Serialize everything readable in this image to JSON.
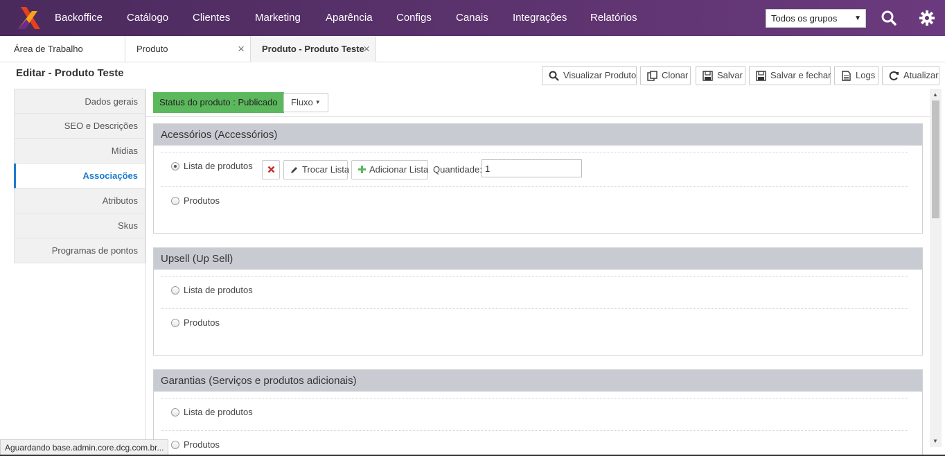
{
  "brand": {
    "logo_icon": "logo-x-icon",
    "accent": "#5e3470",
    "logo_colors": [
      "#e8401c",
      "#f7a21b",
      "#6a2c8a"
    ]
  },
  "nav": {
    "items": [
      "Backoffice",
      "Catálogo",
      "Clientes",
      "Marketing",
      "Aparência",
      "Configs",
      "Canais",
      "Integrações",
      "Relatórios"
    ],
    "group_select": "Todos os grupos",
    "search_icon": "search-icon",
    "settings_icon": "gear-icon"
  },
  "tabs": [
    {
      "label": "Área de Trabalho"
    },
    {
      "label": "Produto",
      "close": "×"
    },
    {
      "label": "Produto - Produto Teste",
      "close": "×",
      "active": true
    }
  ],
  "page": {
    "title": "Editar - Produto Teste"
  },
  "toolbar": {
    "view": "Visualizar Produto",
    "clone": "Clonar",
    "save": "Salvar",
    "save_close": "Salvar e fechar",
    "logs": "Logs",
    "refresh": "Atualizar"
  },
  "sidebar": {
    "items": [
      "Dados gerais",
      "SEO e Descrições",
      "Mídias",
      "Associações",
      "Atributos",
      "Skus",
      "Programas de pontos"
    ],
    "active": "Associações"
  },
  "status": {
    "badge": "Status do produto : Publicado",
    "badge_color": "#5cb85c",
    "flow_button": "Fluxo"
  },
  "panels": [
    {
      "title": "Acessórios (Accessórios)",
      "option_list": "Lista de produtos",
      "option_products": "Produtos",
      "selected": "Lista de produtos",
      "remove_icon": "remove-x-icon",
      "change_list": "Trocar Lista",
      "add_list": "Adicionar Lista",
      "quantity_label": "Quantidade:",
      "quantity_value": "1"
    },
    {
      "title": "Upsell (Up Sell)",
      "option_list": "Lista de produtos",
      "option_products": "Produtos"
    },
    {
      "title": "Garantias (Serviços e produtos adicionais)",
      "option_list": "Lista de produtos",
      "option_products": "Produtos"
    }
  ],
  "browser_status": "Aguardando base.admin.core.dcg.com.br..."
}
